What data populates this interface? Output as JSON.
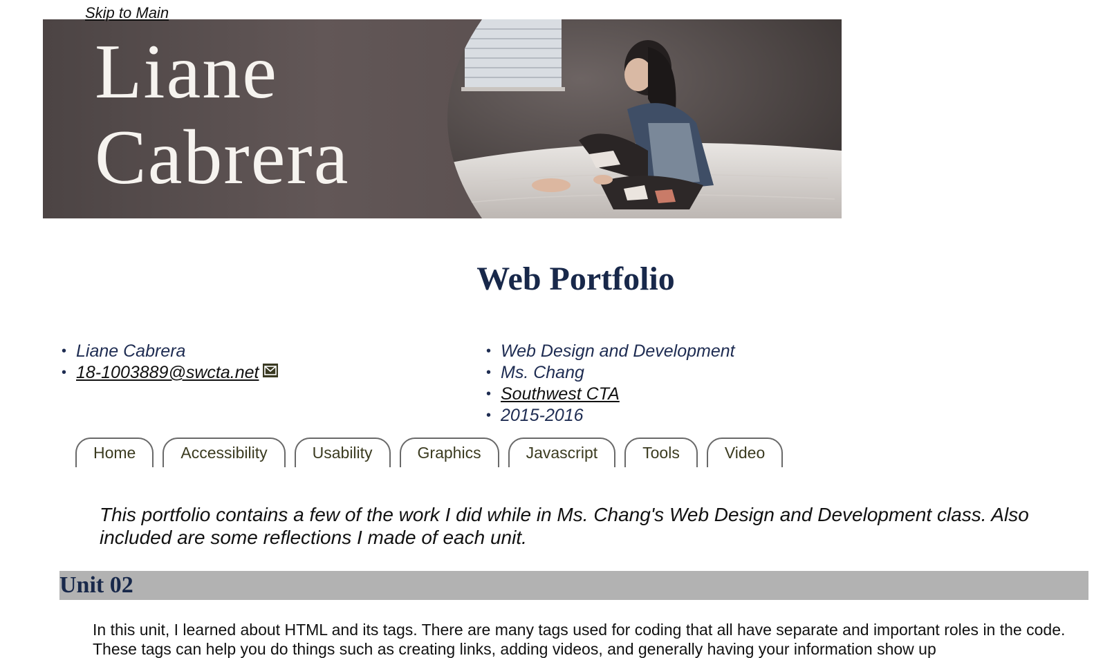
{
  "skip_link": "Skip to Main",
  "banner": {
    "name_line1": "Liane",
    "name_line2": "Cabrera"
  },
  "page_title": "Web Portfolio",
  "student_info": {
    "name": "Liane Cabrera",
    "email": "18-1003889@swcta.net",
    "email_icon": "envelope-icon"
  },
  "course_info": {
    "course": "Web Design and Development",
    "teacher": "Ms. Chang",
    "school": "Southwest CTA",
    "year": "2015-2016"
  },
  "nav": {
    "tabs": [
      "Home",
      "Accessibility",
      "Usability",
      "Graphics",
      "Javascript",
      "Tools",
      "Video"
    ]
  },
  "intro": "This portfolio contains a few of the work I did while in Ms. Chang's Web Design and Development class. Also included are some reflections I made of each unit.",
  "unit": {
    "heading": "Unit 02",
    "text": "In this unit, I learned about HTML and its tags. There are many tags used for coding that all have separate and important roles in the code. These tags can help you do things such as creating links, adding videos, and generally having your information show up"
  },
  "colors": {
    "title": "#18284a",
    "heading_bg": "#b2b2b2",
    "banner_bg": "#5b5050",
    "nav_border": "#696969"
  }
}
